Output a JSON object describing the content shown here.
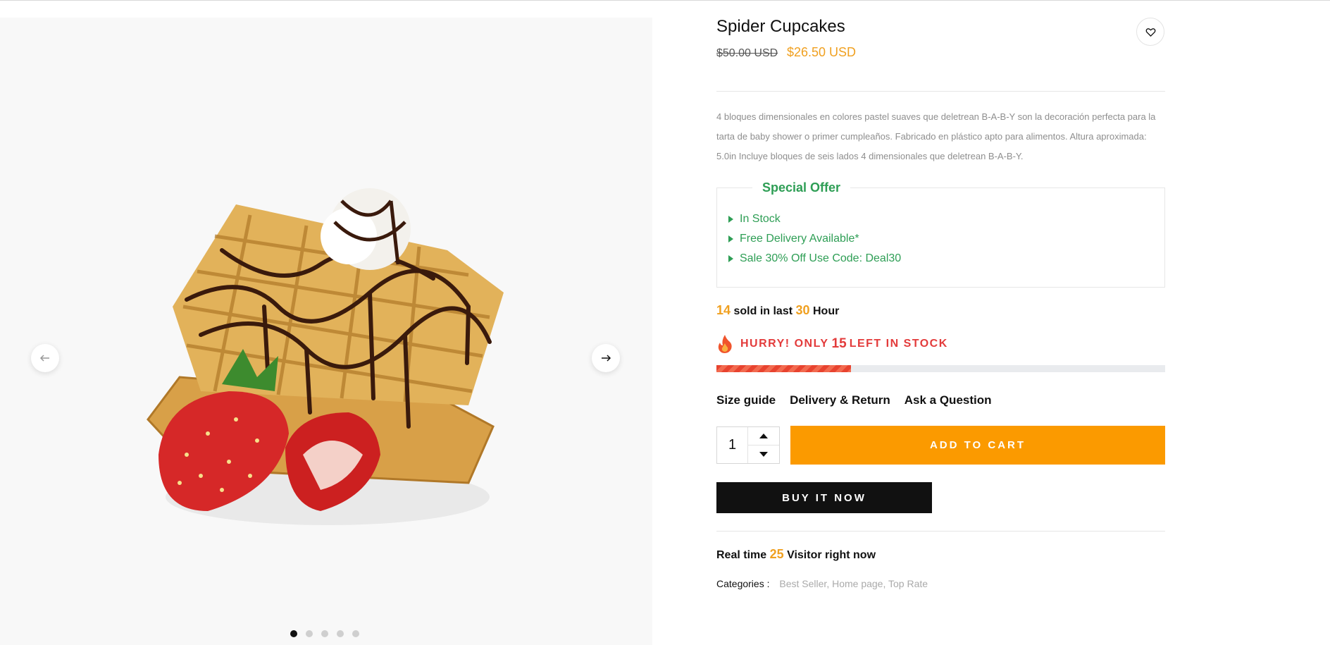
{
  "product": {
    "title": "Spider Cupcakes",
    "price_old": "$50.00 USD",
    "price_new": "$26.50 USD",
    "description": "4 bloques dimensionales en colores pastel suaves que deletrean B-A-B-Y son la decoración perfecta para la tarta de baby shower o primer cumpleaños. Fabricado en plástico apto para alimentos. Altura aproximada: 5.0in Incluye bloques de seis lados 4 dimensionales que deletrean B-A-B-Y."
  },
  "offer": {
    "title": "Special Offer",
    "items": [
      "In Stock",
      "Free Delivery Available*",
      "Sale 30% Off Use Code: Deal30"
    ]
  },
  "sold": {
    "count": "14",
    "text_mid": "sold in last",
    "hours": "30",
    "text_end": "Hour"
  },
  "hurry": {
    "prefix": "HURRY! ONLY",
    "count": "15",
    "suffix": "LEFT IN STOCK",
    "stock_fraction": 0.3
  },
  "links": {
    "size_guide": "Size guide",
    "delivery": "Delivery & Return",
    "ask": "Ask a Question"
  },
  "cart": {
    "quantity": "1",
    "add_label": "ADD TO CART",
    "buy_label": "BUY IT NOW"
  },
  "visitors": {
    "prefix": "Real time",
    "count": "25",
    "suffix": "Visitor right now"
  },
  "categories": {
    "label": "Categories :",
    "items": [
      "Best Seller",
      "Home page",
      "Top Rate"
    ]
  },
  "gallery": {
    "slide_count": 5,
    "active_slide": 1
  },
  "colors": {
    "accent": "#f0a020",
    "cart_button": "#fb9a00",
    "offer_green": "#2e9e55",
    "hurry_red": "#e33b3b"
  }
}
